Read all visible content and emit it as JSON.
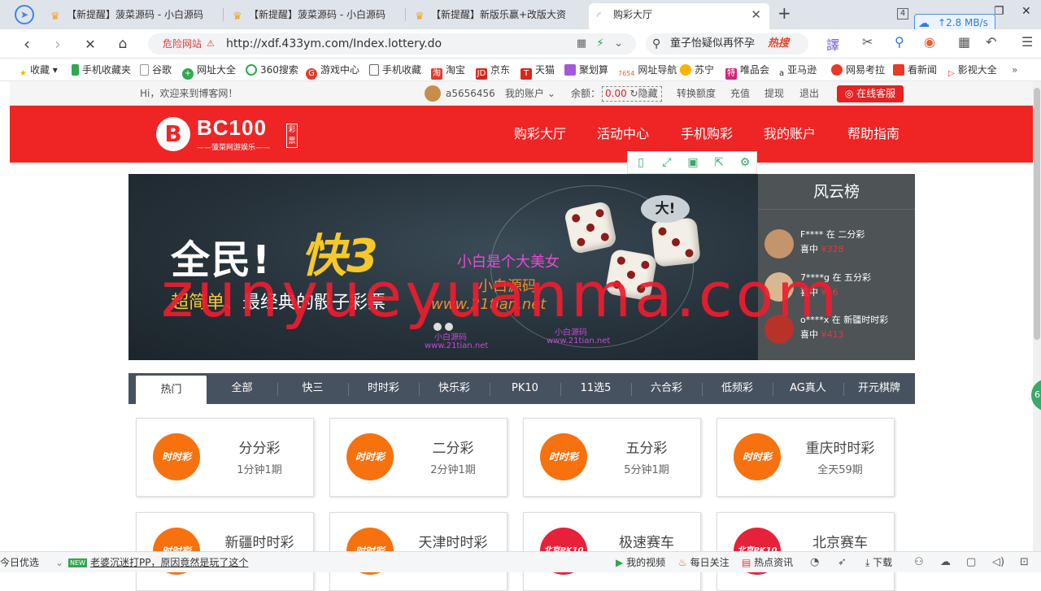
{
  "browser": {
    "tabs": [
      {
        "title": "【新提醒】菠菜源码 - 小白源码",
        "active": false
      },
      {
        "title": "【新提醒】菠菜源码 - 小白源码",
        "active": false
      },
      {
        "title": "【新提醒】新版乐赢+改版大资",
        "active": false
      },
      {
        "title": "购彩大厅",
        "active": true
      }
    ],
    "tab_count": "4",
    "speed": "2.8 MB/s",
    "danger_label": "危险网站",
    "url": "http://xdf.433ym.com/Index.lottery.do",
    "search_text": "童子怡疑似再怀孕",
    "search_hot": "热搜",
    "bookmarks": [
      "收藏",
      "手机收藏夹",
      "谷歌",
      "网址大全",
      "360搜索",
      "游戏中心",
      "手机收藏",
      "淘宝",
      "京东",
      "天猫",
      "聚划算",
      "网址导航",
      "苏宁",
      "唯品会",
      "亚马逊",
      "网易考拉",
      "看新闻",
      "影视大全"
    ]
  },
  "topbar": {
    "welcome": "Hi，欢迎来到博客网！",
    "username": "a5656456",
    "my_account": "我的账户",
    "balance_label": "余额：",
    "balance_value": "0.00",
    "hide": "隐藏",
    "links": [
      "转换额度",
      "充值",
      "提现",
      "退出"
    ],
    "service": "在线客服"
  },
  "header": {
    "logo_letter": "B",
    "logo_name": "BC100",
    "logo_slogan": "——菠菜网游娱乐——",
    "logo_seal": "彩票",
    "nav": [
      "购彩大厅",
      "活动中心",
      "手机购彩",
      "我的账户",
      "帮助指南"
    ]
  },
  "banner": {
    "headline_white": "全民!",
    "headline_yellow": "快3",
    "sub_a": "超简单、",
    "sub_b": "最经典的骰子彩票",
    "bubble": "大!",
    "wm_pink": "小白是个大美女",
    "wm_orange": "小白源码",
    "wm_url": "www.21tian.net",
    "wm_small_1": "小白源码",
    "wm_small_2": "www.21tian.net"
  },
  "ranking": {
    "title": "风云榜",
    "items": [
      {
        "user": "F****",
        "game": "在 二分彩",
        "win_label": "喜中",
        "amount": "¥328"
      },
      {
        "user": "7****g",
        "game": "在 五分彩",
        "win_label": "喜中",
        "amount": "¥56"
      },
      {
        "user": "o****x",
        "game": "在 新疆时时彩",
        "win_label": "喜中",
        "amount": "¥413"
      }
    ]
  },
  "watermark": "zunyueyuanma.com",
  "categories": [
    "热门",
    "全部",
    "快三",
    "时时彩",
    "快乐彩",
    "PK10",
    "11选5",
    "六合彩",
    "低频彩",
    "AG真人",
    "开元棋牌"
  ],
  "games": [
    {
      "name": "分分彩",
      "period": "1分钟1期",
      "icon": "时时彩"
    },
    {
      "name": "二分彩",
      "period": "2分钟1期",
      "icon": "时时彩"
    },
    {
      "name": "五分彩",
      "period": "5分钟1期",
      "icon": "时时彩"
    },
    {
      "name": "重庆时时彩",
      "period": "全天59期",
      "icon": "时时彩"
    },
    {
      "name": "新疆时时彩",
      "period": "",
      "icon": "时时彩"
    },
    {
      "name": "天津时时彩",
      "period": "",
      "icon": "时时彩"
    },
    {
      "name": "极速赛车",
      "period": "",
      "icon": "北京PK10"
    },
    {
      "name": "北京赛车",
      "period": "",
      "icon": "北京PK10"
    }
  ],
  "statusbar": {
    "left": "今日优选",
    "news": "老婆沉迷打PP，原因竟然是玩了这个",
    "items": [
      "我的视频",
      "每日关注",
      "热点资讯",
      "下载"
    ]
  },
  "colors": {
    "brand_red": "#ef2525",
    "nav_bg": "#475260",
    "lottery_orange": "#f7720f"
  }
}
